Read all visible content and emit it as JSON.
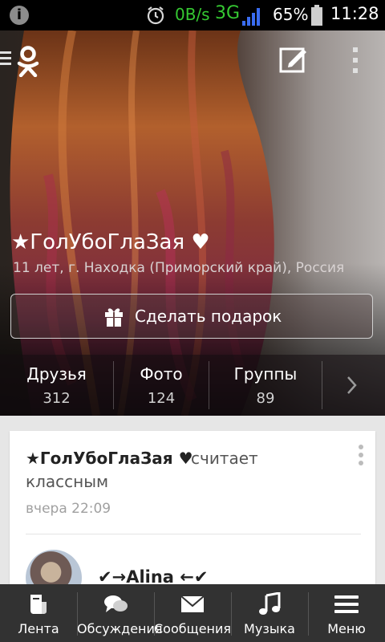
{
  "status_bar": {
    "speed": "0B/s",
    "network": "3G",
    "battery_percent": "65%",
    "time": "11:28",
    "icons": [
      "info-icon",
      "alarm-icon",
      "signal-icon",
      "battery-icon"
    ]
  },
  "profile": {
    "name": "★ГолУбоГлаЗая ♥",
    "location": "11 лет, г. Находка (Приморский край), Россия",
    "gift_button": "Сделать подарок",
    "stats": [
      {
        "label": "Друзья",
        "count": "312"
      },
      {
        "label": "Фото",
        "count": "124"
      },
      {
        "label": "Группы",
        "count": "89"
      }
    ]
  },
  "feed": {
    "author": "★ГолУбоГлаЗая ♥",
    "action_line1": "считает",
    "action_line2": "классным",
    "timestamp": "вчера 22:09",
    "friend_name": "✔→Alina ←✔"
  },
  "bottom_nav": [
    {
      "label": "Лента",
      "icon": "feed-icon"
    },
    {
      "label": "Обсуждения",
      "icon": "discussions-icon"
    },
    {
      "label": "Сообщения",
      "icon": "messages-icon"
    },
    {
      "label": "Музыка",
      "icon": "music-icon"
    },
    {
      "label": "Меню",
      "icon": "menu-icon"
    }
  ],
  "colors": {
    "status_green": "#35c832",
    "nav_bg": "#323232",
    "feed_bg": "#e6e6e6"
  }
}
